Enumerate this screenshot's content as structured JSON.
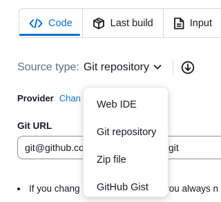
{
  "tabs": [
    {
      "label": "Code",
      "icon": "code-icon",
      "active": true
    },
    {
      "label": "Last build",
      "icon": "package-icon",
      "active": false
    },
    {
      "label": "Input",
      "icon": "document-icon",
      "active": false
    }
  ],
  "source_type": {
    "label": "Source type:",
    "value": "Git repository",
    "chevron_icon": "chevron-down-icon",
    "download_icon": "download-circle-icon"
  },
  "provider": {
    "label": "Provider",
    "change_link": "Chan"
  },
  "git_url": {
    "label": "Git URL",
    "value": "git@github.co",
    "value_suffix": "git"
  },
  "note": {
    "text": "If you chang",
    "text_suffix": "you always n"
  },
  "dropdown": {
    "items": [
      "Web IDE",
      "Git repository",
      "Zip file",
      "GitHub Gist"
    ]
  },
  "colors": {
    "accent": "#0972d3",
    "text": "#16191f",
    "muted": "#5f6b7a",
    "border": "#d5dbdb"
  }
}
